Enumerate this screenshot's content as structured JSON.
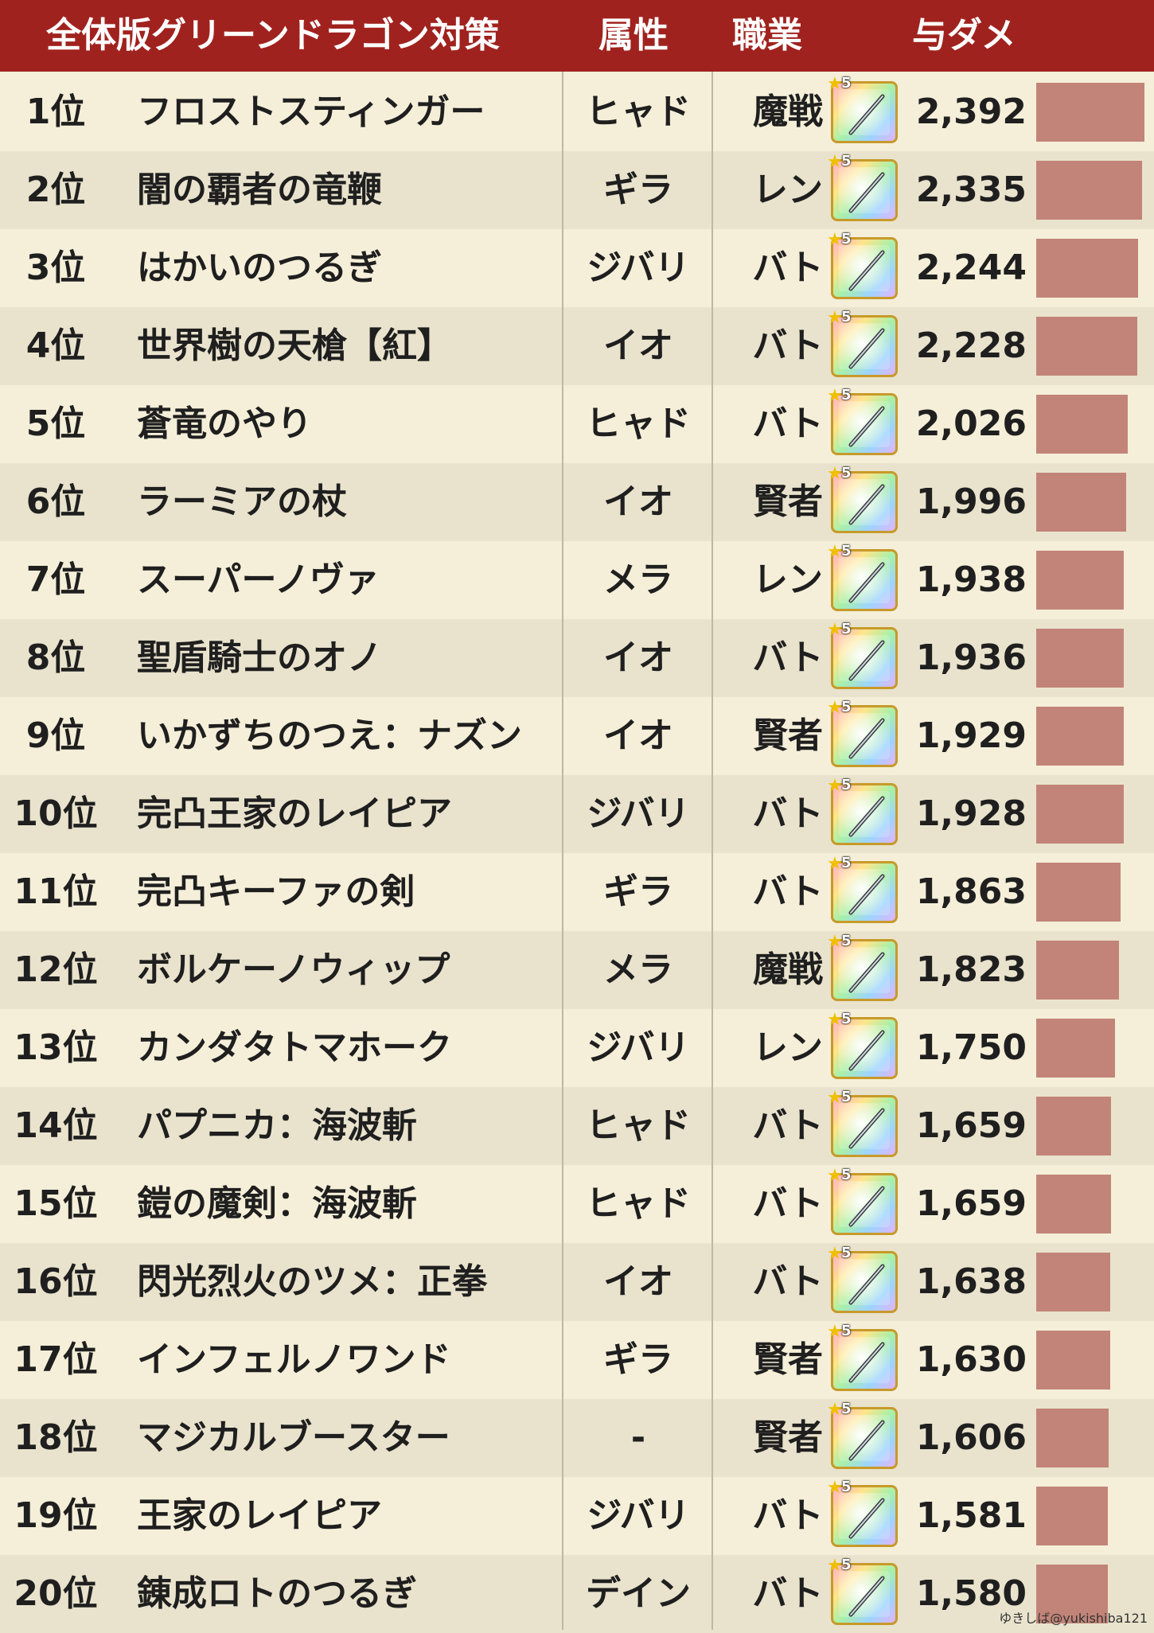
{
  "header": {
    "title": "全体版グリーンドラゴン対策",
    "attribute": "属性",
    "job": "職業",
    "damage": "与ダメ"
  },
  "icon_rarity": "5",
  "credit": "ゆきしば@yukishiba121",
  "colors": {
    "header_bg": "#a0221e",
    "bar": "#c28478",
    "row_light": "#f5efd9",
    "row_dark": "#e9e3cd"
  },
  "chart_data": {
    "type": "bar",
    "orientation": "horizontal",
    "title": "全体版グリーンドラゴン対策",
    "columns": [
      "属性",
      "職業",
      "与ダメ"
    ],
    "xlim": [
      0,
      2392
    ],
    "rows": [
      {
        "rank": "1位",
        "name": "フロストスティンガー",
        "attribute": "ヒャド",
        "job": "魔戦",
        "damage_label": "2,392",
        "value": 2392
      },
      {
        "rank": "2位",
        "name": "闇の覇者の竜鞭",
        "attribute": "ギラ",
        "job": "レン",
        "damage_label": "2,335",
        "value": 2335
      },
      {
        "rank": "3位",
        "name": "はかいのつるぎ",
        "attribute": "ジバリ",
        "job": "バト",
        "damage_label": "2,244",
        "value": 2244
      },
      {
        "rank": "4位",
        "name": "世界樹の天槍【紅】",
        "attribute": "イオ",
        "job": "バト",
        "damage_label": "2,228",
        "value": 2228
      },
      {
        "rank": "5位",
        "name": "蒼竜のやり",
        "attribute": "ヒャド",
        "job": "バト",
        "damage_label": "2,026",
        "value": 2026
      },
      {
        "rank": "6位",
        "name": "ラーミアの杖",
        "attribute": "イオ",
        "job": "賢者",
        "damage_label": "1,996",
        "value": 1996
      },
      {
        "rank": "7位",
        "name": "スーパーノヴァ",
        "attribute": "メラ",
        "job": "レン",
        "damage_label": "1,938",
        "value": 1938
      },
      {
        "rank": "8位",
        "name": "聖盾騎士のオノ",
        "attribute": "イオ",
        "job": "バト",
        "damage_label": "1,936",
        "value": 1936
      },
      {
        "rank": "9位",
        "name": "いかずちのつえ：ナズン",
        "attribute": "イオ",
        "job": "賢者",
        "damage_label": "1,929",
        "value": 1929
      },
      {
        "rank": "10位",
        "name": "完凸王家のレイピア",
        "attribute": "ジバリ",
        "job": "バト",
        "damage_label": "1,928",
        "value": 1928
      },
      {
        "rank": "11位",
        "name": "完凸キーファの剣",
        "attribute": "ギラ",
        "job": "バト",
        "damage_label": "1,863",
        "value": 1863
      },
      {
        "rank": "12位",
        "name": "ボルケーノウィップ",
        "attribute": "メラ",
        "job": "魔戦",
        "damage_label": "1,823",
        "value": 1823
      },
      {
        "rank": "13位",
        "name": "カンダタトマホーク",
        "attribute": "ジバリ",
        "job": "レン",
        "damage_label": "1,750",
        "value": 1750
      },
      {
        "rank": "14位",
        "name": "パプニカ：海波斬",
        "attribute": "ヒャド",
        "job": "バト",
        "damage_label": "1,659",
        "value": 1659
      },
      {
        "rank": "15位",
        "name": "鎧の魔剣：海波斬",
        "attribute": "ヒャド",
        "job": "バト",
        "damage_label": "1,659",
        "value": 1659
      },
      {
        "rank": "16位",
        "name": "閃光烈火のツメ：正拳",
        "attribute": "イオ",
        "job": "バト",
        "damage_label": "1,638",
        "value": 1638
      },
      {
        "rank": "17位",
        "name": "インフェルノワンド",
        "attribute": "ギラ",
        "job": "賢者",
        "damage_label": "1,630",
        "value": 1630
      },
      {
        "rank": "18位",
        "name": "マジカルブースター",
        "attribute": "-",
        "job": "賢者",
        "damage_label": "1,606",
        "value": 1606
      },
      {
        "rank": "19位",
        "name": "王家のレイピア",
        "attribute": "ジバリ",
        "job": "バト",
        "damage_label": "1,581",
        "value": 1581
      },
      {
        "rank": "20位",
        "name": "錬成ロトのつるぎ",
        "attribute": "デイン",
        "job": "バト",
        "damage_label": "1,580",
        "value": 1580
      }
    ]
  }
}
